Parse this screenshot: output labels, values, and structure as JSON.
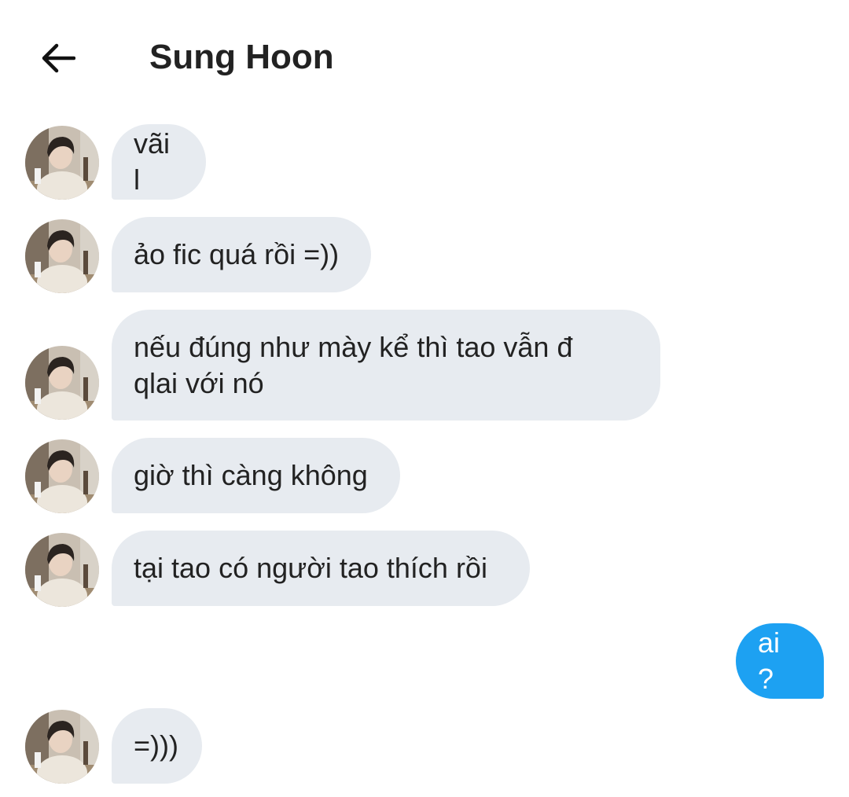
{
  "header": {
    "back_icon": "arrow-left-icon",
    "title": "Sung Hoon"
  },
  "messages": [
    {
      "from": "contact",
      "text": "vãi l"
    },
    {
      "from": "contact",
      "text": "ảo fic quá rồi =))"
    },
    {
      "from": "contact",
      "text": "nếu đúng như mày kể thì tao vẫn đ\nqlai với nó"
    },
    {
      "from": "contact",
      "text": "giờ thì càng không"
    },
    {
      "from": "contact",
      "text": "tại tao có người tao thích rồi"
    },
    {
      "from": "me",
      "text": "ai ?"
    },
    {
      "from": "contact",
      "text": "=)))"
    }
  ],
  "colors": {
    "incoming_bubble": "#e7ebf0",
    "outgoing_bubble": "#1da1f2"
  }
}
